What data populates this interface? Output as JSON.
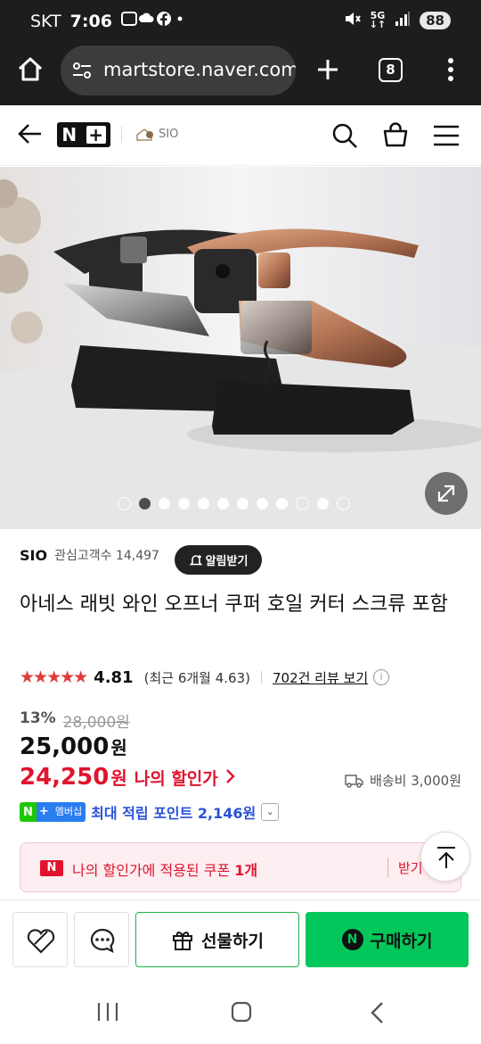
{
  "status": {
    "carrier": "SKT",
    "time": "7:06",
    "battery": "88",
    "network": "5G"
  },
  "browser": {
    "url": "martstore.naver.com",
    "tab_count": "8"
  },
  "site": {
    "logo_n": "N",
    "logo_plus": "+",
    "store_label": "SIO"
  },
  "gallery": {
    "total_slides": 11,
    "active_index": 1
  },
  "shop": {
    "name": "SIO",
    "followers_label": "관심고객수",
    "followers": "14,497",
    "alarm_label": "알림받기"
  },
  "product": {
    "title": "아네스 래빗 와인 오프너 쿠퍼 호일 커터 스크류 포함",
    "rating": "4.81",
    "recent_rating": "(최근 6개월 4.63)",
    "reviews": "702건 리뷰 보기",
    "discount_rate": "13%",
    "original_price": "28,000원",
    "price": "25,000",
    "price_unit": "원",
    "my_price": "24,250",
    "my_price_unit": "원",
    "my_price_label": "나의 할인가",
    "shipping": "배송비 3,000원",
    "membership_n": "N",
    "membership_plus": "+",
    "membership_label": "멤버십",
    "points_text": "최대 적립 포인트 2,146원"
  },
  "coupon": {
    "badge": "N",
    "text": "나의 할인가에 적용된 쿠폰",
    "count": "1개",
    "action": "받기"
  },
  "actions": {
    "gift_label": "선물하기",
    "buy_label": "구매하기",
    "buy_badge": "N"
  },
  "colors": {
    "accent_red": "#e0142e",
    "naver_green": "#03c75a",
    "star": "#e03a3a",
    "points_blue": "#2a52d6"
  }
}
